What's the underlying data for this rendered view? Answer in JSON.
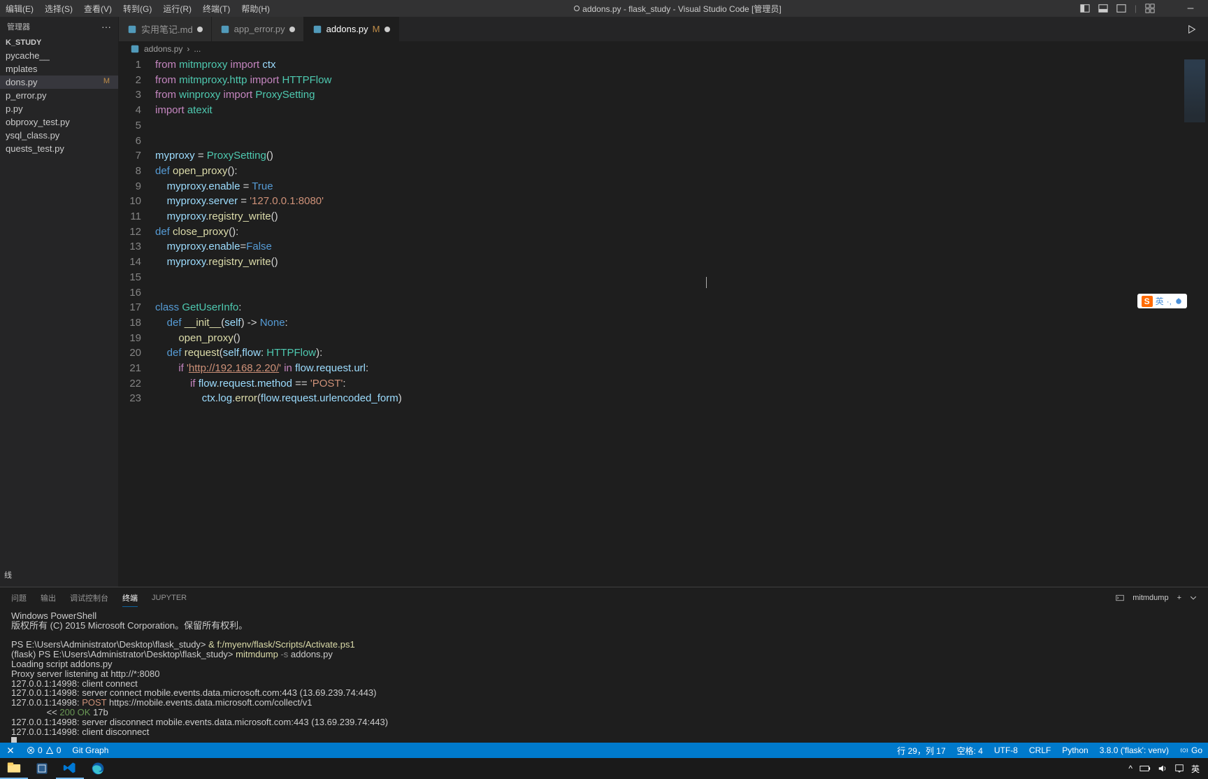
{
  "titlebar": {
    "menus": [
      "编辑(E)",
      "选择(S)",
      "查看(V)",
      "转到(G)",
      "运行(R)",
      "终端(T)",
      "帮助(H)"
    ],
    "title": "addons.py - flask_study - Visual Studio Code [管理员]"
  },
  "explorer": {
    "header": "管理器",
    "project": "K_STUDY",
    "files": [
      {
        "name": "pycache__",
        "m": false
      },
      {
        "name": "mplates",
        "m": false
      },
      {
        "name": "dons.py",
        "m": true,
        "active": true
      },
      {
        "name": "p_error.py",
        "m": false
      },
      {
        "name": "p.py",
        "m": false
      },
      {
        "name": "obproxy_test.py",
        "m": false
      },
      {
        "name": "ysql_class.py",
        "m": false
      },
      {
        "name": "quests_test.py",
        "m": false
      }
    ],
    "outline": "线"
  },
  "tabs": [
    {
      "icon": "md",
      "label": "实用笔记.md",
      "modified": true,
      "active": false
    },
    {
      "icon": "py",
      "label": "app_error.py",
      "modified": true,
      "active": false
    },
    {
      "icon": "py",
      "label": "addons.py",
      "suffix": "M",
      "modified": true,
      "active": true
    }
  ],
  "breadcrumb": {
    "file": "addons.py",
    "sep": "›",
    "more": "..."
  },
  "code": {
    "lines": [
      [
        {
          "t": "from ",
          "c": "kw"
        },
        {
          "t": "mitmproxy ",
          "c": "mod"
        },
        {
          "t": "import ",
          "c": "kw"
        },
        {
          "t": "ctx",
          "c": "var"
        }
      ],
      [
        {
          "t": "from ",
          "c": "kw"
        },
        {
          "t": "mitmproxy",
          "c": "mod"
        },
        {
          "t": ".",
          "c": "op"
        },
        {
          "t": "http ",
          "c": "mod"
        },
        {
          "t": "import ",
          "c": "kw"
        },
        {
          "t": "HTTPFlow",
          "c": "cls"
        }
      ],
      [
        {
          "t": "from ",
          "c": "kw"
        },
        {
          "t": "winproxy ",
          "c": "mod"
        },
        {
          "t": "import ",
          "c": "kw"
        },
        {
          "t": "ProxySetting",
          "c": "cls"
        }
      ],
      [
        {
          "t": "import ",
          "c": "kw"
        },
        {
          "t": "atexit",
          "c": "mod"
        }
      ],
      [],
      [],
      [
        {
          "t": "myproxy ",
          "c": "var"
        },
        {
          "t": "= ",
          "c": "op"
        },
        {
          "t": "ProxySetting",
          "c": "cls"
        },
        {
          "t": "()",
          "c": "op"
        }
      ],
      [
        {
          "t": "def ",
          "c": "const"
        },
        {
          "t": "open_proxy",
          "c": "fn"
        },
        {
          "t": "():",
          "c": "op"
        }
      ],
      [
        {
          "t": "    myproxy",
          "c": "var"
        },
        {
          "t": ".",
          "c": "op"
        },
        {
          "t": "enable ",
          "c": "var"
        },
        {
          "t": "= ",
          "c": "op"
        },
        {
          "t": "True",
          "c": "const"
        }
      ],
      [
        {
          "t": "    myproxy",
          "c": "var"
        },
        {
          "t": ".",
          "c": "op"
        },
        {
          "t": "server ",
          "c": "var"
        },
        {
          "t": "= ",
          "c": "op"
        },
        {
          "t": "'127.0.0.1:8080'",
          "c": "str"
        }
      ],
      [
        {
          "t": "    myproxy",
          "c": "var"
        },
        {
          "t": ".",
          "c": "op"
        },
        {
          "t": "registry_write",
          "c": "fn"
        },
        {
          "t": "()",
          "c": "op"
        }
      ],
      [
        {
          "t": "def ",
          "c": "const"
        },
        {
          "t": "close_proxy",
          "c": "fn"
        },
        {
          "t": "():",
          "c": "op"
        }
      ],
      [
        {
          "t": "    myproxy",
          "c": "var"
        },
        {
          "t": ".",
          "c": "op"
        },
        {
          "t": "enable",
          "c": "var"
        },
        {
          "t": "=",
          "c": "op"
        },
        {
          "t": "False",
          "c": "const"
        }
      ],
      [
        {
          "t": "    myproxy",
          "c": "var"
        },
        {
          "t": ".",
          "c": "op"
        },
        {
          "t": "registry_write",
          "c": "fn"
        },
        {
          "t": "()",
          "c": "op"
        }
      ],
      [],
      [],
      [
        {
          "t": "class ",
          "c": "const"
        },
        {
          "t": "GetUserInfo",
          "c": "cls"
        },
        {
          "t": ":",
          "c": "op"
        }
      ],
      [
        {
          "t": "    ",
          "c": "op"
        },
        {
          "t": "def ",
          "c": "const"
        },
        {
          "t": "__init__",
          "c": "fn"
        },
        {
          "t": "(",
          "c": "op"
        },
        {
          "t": "self",
          "c": "var"
        },
        {
          "t": ") -> ",
          "c": "op"
        },
        {
          "t": "None",
          "c": "const"
        },
        {
          "t": ":",
          "c": "op"
        }
      ],
      [
        {
          "t": "        ",
          "c": "op"
        },
        {
          "t": "open_proxy",
          "c": "fn"
        },
        {
          "t": "()",
          "c": "op"
        }
      ],
      [
        {
          "t": "    ",
          "c": "op"
        },
        {
          "t": "def ",
          "c": "const"
        },
        {
          "t": "request",
          "c": "fn"
        },
        {
          "t": "(",
          "c": "op"
        },
        {
          "t": "self",
          "c": "var"
        },
        {
          "t": ",",
          "c": "op"
        },
        {
          "t": "flow",
          "c": "var"
        },
        {
          "t": ": ",
          "c": "op"
        },
        {
          "t": "HTTPFlow",
          "c": "cls"
        },
        {
          "t": "):",
          "c": "op"
        }
      ],
      [
        {
          "t": "        ",
          "c": "op"
        },
        {
          "t": "if ",
          "c": "kw"
        },
        {
          "t": "'",
          "c": "str"
        },
        {
          "t": "http://192.168.2.20/",
          "c": "str underline"
        },
        {
          "t": "'",
          "c": "str"
        },
        {
          "t": " in ",
          "c": "kw"
        },
        {
          "t": "flow",
          "c": "var"
        },
        {
          "t": ".",
          "c": "op"
        },
        {
          "t": "request",
          "c": "var"
        },
        {
          "t": ".",
          "c": "op"
        },
        {
          "t": "url",
          "c": "var"
        },
        {
          "t": ":",
          "c": "op"
        }
      ],
      [
        {
          "t": "            ",
          "c": "op"
        },
        {
          "t": "if ",
          "c": "kw"
        },
        {
          "t": "flow",
          "c": "var"
        },
        {
          "t": ".",
          "c": "op"
        },
        {
          "t": "request",
          "c": "var"
        },
        {
          "t": ".",
          "c": "op"
        },
        {
          "t": "method ",
          "c": "var"
        },
        {
          "t": "== ",
          "c": "op"
        },
        {
          "t": "'POST'",
          "c": "str"
        },
        {
          "t": ":",
          "c": "op"
        }
      ],
      [
        {
          "t": "                ",
          "c": "op"
        },
        {
          "t": "ctx",
          "c": "var"
        },
        {
          "t": ".",
          "c": "op"
        },
        {
          "t": "log",
          "c": "var"
        },
        {
          "t": ".",
          "c": "op"
        },
        {
          "t": "error",
          "c": "fn"
        },
        {
          "t": "(",
          "c": "op"
        },
        {
          "t": "flow",
          "c": "var"
        },
        {
          "t": ".",
          "c": "op"
        },
        {
          "t": "request",
          "c": "var"
        },
        {
          "t": ".",
          "c": "op"
        },
        {
          "t": "urlencoded_form",
          "c": "var"
        },
        {
          "t": ")",
          "c": "op"
        }
      ]
    ]
  },
  "panel": {
    "tabs": [
      "问题",
      "输出",
      "调试控制台",
      "终端",
      "JUPYTER"
    ],
    "active_tab": 3,
    "terminal_label": "mitmdump",
    "terminal_lines": [
      "Windows PowerShell",
      "版权所有 (C) 2015 Microsoft Corporation。保留所有权利。",
      "",
      "PS E:\\Users\\Administrator\\Desktop\\flask_study> & f:/myenv/flask/Scripts/Activate.ps1",
      "(flask) PS E:\\Users\\Administrator\\Desktop\\flask_study> mitmdump -s addons.py",
      "Loading script addons.py",
      "Proxy server listening at http://*:8080",
      "127.0.0.1:14998: client connect",
      "127.0.0.1:14998: server connect mobile.events.data.microsoft.com:443 (13.69.239.74:443)",
      "127.0.0.1:14998: POST https://mobile.events.data.microsoft.com/collect/v1",
      "              << 200 OK 17b",
      "127.0.0.1:14998: server disconnect mobile.events.data.microsoft.com:443 (13.69.239.74:443)",
      "127.0.0.1:14998: client disconnect"
    ]
  },
  "statusbar": {
    "left": {
      "errors": "0",
      "warnings": "0",
      "git": "Git Graph"
    },
    "right": {
      "pos": "行 29，列 17",
      "spaces": "空格: 4",
      "encoding": "UTF-8",
      "eol": "CRLF",
      "lang": "Python",
      "env": "3.8.0 ('flask': venv)",
      "go": "Go"
    }
  },
  "taskbar": {
    "right": {
      "ime": "英",
      "chevron": "^"
    }
  },
  "ime": {
    "s": "S",
    "lang": "英"
  }
}
